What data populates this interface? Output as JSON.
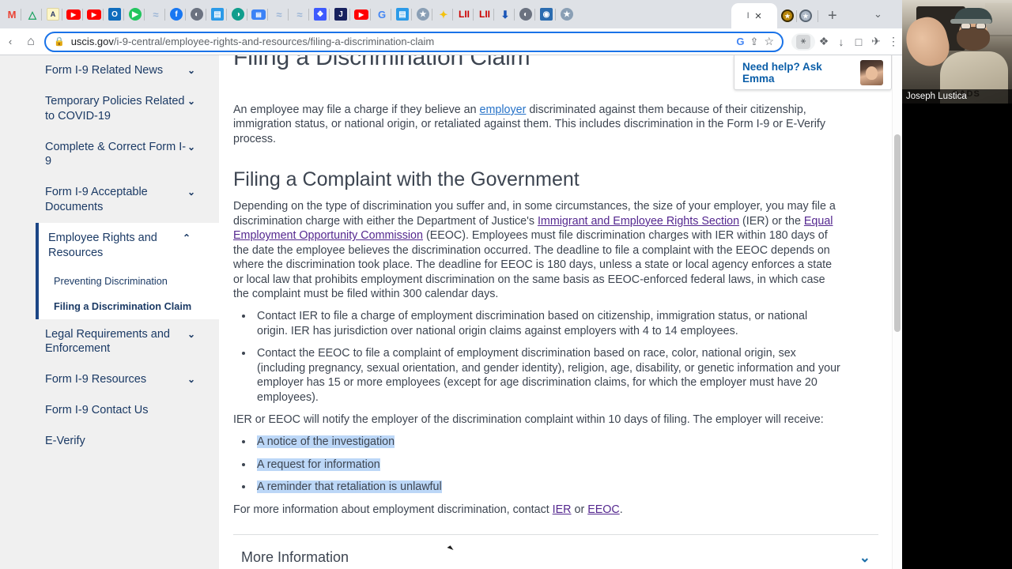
{
  "browser": {
    "bookmarks": [
      {
        "name": "gmail",
        "label": "M",
        "color": "#ea4335",
        "kind": "glyph"
      },
      {
        "name": "google-drive",
        "label": "△",
        "color": "#1aa260",
        "kind": "glyph"
      },
      {
        "name": "a-l-note",
        "label": "A",
        "color": "#2b3a67",
        "kind": "note"
      },
      {
        "name": "youtube-1",
        "label": "▶",
        "color": "#ff0000",
        "kind": "rect"
      },
      {
        "name": "youtube-2",
        "label": "▶",
        "color": "#ff0000",
        "kind": "rect"
      },
      {
        "name": "outlook",
        "label": "O",
        "color": "#0f6cbd",
        "kind": "sq"
      },
      {
        "name": "play-green",
        "label": "▶",
        "color": "#22c55e",
        "kind": "circ"
      },
      {
        "name": "layers-1",
        "label": "≈",
        "color": "#9bb5d6",
        "kind": "glyph"
      },
      {
        "name": "facebook",
        "label": "f",
        "color": "#1877f2",
        "kind": "circ"
      },
      {
        "name": "globe-grey",
        "label": "◐",
        "color": "#6b7280",
        "kind": "circ"
      },
      {
        "name": "id-badge-blue",
        "label": "▤",
        "color": "#2b9ae8",
        "kind": "sq"
      },
      {
        "name": "globe-teal",
        "label": "◑",
        "color": "#0f9d8c",
        "kind": "circ"
      },
      {
        "name": "document-blue",
        "label": "▤",
        "color": "#3b82f6",
        "kind": "rect"
      },
      {
        "name": "layers-2",
        "label": "≈",
        "color": "#9bb5d6",
        "kind": "glyph"
      },
      {
        "name": "layers-3",
        "label": "≈",
        "color": "#9bb5d6",
        "kind": "glyph"
      },
      {
        "name": "dropbox",
        "label": "❖",
        "color": "#3d5afe",
        "kind": "sq"
      },
      {
        "name": "j-app",
        "label": "J",
        "color": "#17215e",
        "kind": "sq"
      },
      {
        "name": "youtube-3",
        "label": "▶",
        "color": "#ff0000",
        "kind": "rect"
      },
      {
        "name": "google-search",
        "label": "G",
        "color": "#4285f4",
        "kind": "glyph"
      },
      {
        "name": "id-badge-blue-2",
        "label": "▤",
        "color": "#2b9ae8",
        "kind": "sq"
      },
      {
        "name": "uscis-seal-1",
        "label": "★",
        "color": "#8a9fb5",
        "kind": "circ"
      },
      {
        "name": "star-yellow",
        "label": "✦",
        "color": "#f4c20d",
        "kind": "glyph"
      },
      {
        "name": "lii-1",
        "label": "LII",
        "color": "#cc0000",
        "kind": "text"
      },
      {
        "name": "lii-2",
        "label": "LII",
        "color": "#cc0000",
        "kind": "text"
      },
      {
        "name": "download-blue",
        "label": "⬇",
        "color": "#1a56b8",
        "kind": "glyph"
      },
      {
        "name": "globe-grey-2",
        "label": "◐",
        "color": "#6b7280",
        "kind": "circ"
      },
      {
        "name": "seal-blue",
        "label": "◉",
        "color": "#2b6cb0",
        "kind": "sq"
      },
      {
        "name": "uscis-seal-2",
        "label": "★",
        "color": "#8a9fb5",
        "kind": "circ"
      }
    ],
    "tab": {
      "favicon_label": "I",
      "close_label": "×",
      "extra_tabs": [
        {
          "name": "tab-seal-gold",
          "label": "◉",
          "color": "#b8860b"
        },
        {
          "name": "tab-seal-grey",
          "label": "◉",
          "color": "#8a9fb5"
        }
      ],
      "new_tab_label": "+",
      "tab_list_chevron": "⌄"
    },
    "omnibox": {
      "back_label": "‹",
      "home_label": "⌂",
      "lock_label": "🔒",
      "url_domain": "uscis.gov",
      "url_path": "/i-9-central/employee-rights-and-resources/filing-a-discrimination-claim",
      "google_label": "G",
      "share_label": "⇧",
      "bookmark_star_label": "☆"
    },
    "toolbar_icons": [
      {
        "name": "accessibility-extension-icon",
        "label": "ᾜd"
      },
      {
        "name": "extensions-puzzle-icon",
        "label": "❖"
      },
      {
        "name": "downloads-icon",
        "label": "⤓"
      },
      {
        "name": "side-panel-icon",
        "label": "□"
      },
      {
        "name": "profile-avatar-icon",
        "label": "⚒"
      },
      {
        "name": "chrome-menu-icon",
        "label": "⋮"
      }
    ]
  },
  "sidebar": {
    "items": [
      {
        "label": "Form I-9 Related News",
        "chevron": "⌄",
        "expandable": true
      },
      {
        "label": "Temporary Policies Related to COVID-19",
        "chevron": "⌄",
        "expandable": true
      },
      {
        "label": "Complete & Correct Form I-9",
        "chevron": "⌄",
        "expandable": true
      },
      {
        "label": "Form I-9 Acceptable Documents",
        "chevron": "⌄",
        "expandable": true
      }
    ],
    "active_group": {
      "label": "Employee Rights and Resources",
      "chevron": "⌃",
      "children": [
        {
          "label": "Preventing Discrimination",
          "current": false
        },
        {
          "label": "Filing a Discrimination Claim",
          "current": true
        }
      ]
    },
    "items_after": [
      {
        "label": "Legal Requirements and Enforcement",
        "chevron": "⌄",
        "expandable": true
      },
      {
        "label": "Form I-9 Resources",
        "chevron": "⌄",
        "expandable": true
      },
      {
        "label": "Form I-9 Contact Us",
        "chevron": "",
        "expandable": false
      },
      {
        "label": "E-Verify",
        "chevron": "",
        "expandable": false
      }
    ]
  },
  "page": {
    "title": "Filing a Discrimination Claim",
    "intro": {
      "part1": "An employee may file a charge if they believe an ",
      "link1": "employer",
      "part2": " discriminated against them because of their citizenship, immigration status, or national origin, or retaliated against them. This includes discrimination in the Form I-9 or E-Verify process."
    },
    "section_heading": "Filing a Complaint with the Government",
    "para2": {
      "part1": "Depending on the type of discrimination you suffer and, in some circumstances, the size of your employer, you may file a discrimination charge with either the Department of Justice's ",
      "link1": "Immigrant and Employee Rights Section",
      "part2": " (IER) or the ",
      "link2": "Equal Employment Opportunity Commission",
      "part3": " (EEOC). Employees must file discrimination charges with IER within 180 days of the date the employee believes the discrimination occurred. The deadline to file a complaint with the EEOC depends on where the discrimination took place. The deadline for EEOC is 180 days, unless a state or local agency enforces a state or local law that prohibits employment discrimination on the same basis as EEOC-enforced federal laws, in which case the complaint must be filed within 300 calendar days."
    },
    "bullets_agencies": [
      "Contact IER to file a charge of employment discrimination based on citizenship, immigration status, or national origin. IER has jurisdiction over national origin claims against employers with 4 to 14 employees.",
      "Contact the EEOC to file a complaint of employment discrimination based on race, color, national origin, sex (including pregnancy, sexual orientation, and gender identity), religion, age, disability, or genetic information and your employer has 15 or more employees (except for age discrimination claims, for which the employer must have 20 employees)."
    ],
    "para3": "IER or EEOC will notify the employer of the discrimination complaint within 10 days of filing. The employer will receive:",
    "bullets_receive": [
      "A notice of the investigation",
      "A request for information",
      "A reminder that retaliation is unlawful"
    ],
    "closing": {
      "part1": "For more information about employment discrimination, contact ",
      "link1": "IER",
      "part2": " or ",
      "link2": "EEOC",
      "part3": "."
    },
    "more_information": {
      "label": "More Information",
      "chevron": "⌄"
    },
    "emma_widget": {
      "text": "Need help? Ask Emma"
    }
  },
  "webcam": {
    "name_label": "Joseph Lustica",
    "shirt_text": "OADS"
  },
  "colors": {
    "accent_blue": "#1b4585",
    "link_visited": "#54278f",
    "link_blue": "#2672c8",
    "selection": "#bcd7f7",
    "sidebar_bg": "#f0f0f0",
    "text": "#3d4551"
  }
}
